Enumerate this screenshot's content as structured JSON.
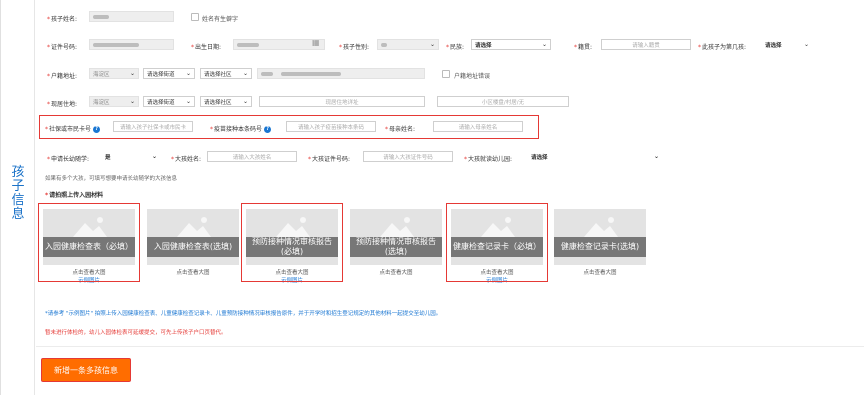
{
  "sidebar": {
    "title_chars": [
      "孩",
      "子",
      "信",
      "息"
    ]
  },
  "row1": {
    "child_name_label": "孩子姓名:",
    "rare_char_label": "姓名有生僻字"
  },
  "row2": {
    "id_label": "证件号码:",
    "dob_label": "出生日期:",
    "gender_label": "孩子性别:",
    "nation_label": "民族:",
    "nation_value": "请选择",
    "origin_label": "籍贯:",
    "origin_placeholder": "请输入籍贯",
    "order_label": "此孩子为第几孩:",
    "order_value": "请选择"
  },
  "row3": {
    "hukou_label": "户籍地址:",
    "district_value": "海淀区",
    "street_value": "请选择街道",
    "community_value": "请选择社区",
    "hukou_error_label": "户籍地址错误"
  },
  "row4": {
    "residence_label": "现居住地:",
    "district_value": "海淀区",
    "street_value": "请选择街道",
    "community_value": "请选择社区",
    "address_placeholder": "现居住地详址",
    "building_placeholder": "小区楼盘/村居/无"
  },
  "row5": {
    "social_label": "社保或市民卡号",
    "social_placeholder": "请输入孩子社保卡或市民卡",
    "vaccine_label": "疫苗接种本条码号",
    "vaccine_placeholder": "请输入孩子疫苗接种本条码",
    "mother_label": "母亲姓名:",
    "mother_placeholder": "请输入母亲姓名",
    "help_glyph": "?"
  },
  "row6": {
    "sibling_label": "申请长幼随学:",
    "sibling_value": "是",
    "elder_name_label": "大孩姓名:",
    "elder_name_placeholder": "请输入大孩姓名",
    "elder_id_label": "大孩证件号码:",
    "elder_id_placeholder": "请输入大孩证件号码",
    "elder_kg_label": "大孩就读幼儿园:",
    "elder_kg_value": "请选择"
  },
  "notes": {
    "multi_child": "如果有多个大孩，可填写想要申请长幼随学的大孩信息",
    "upload_title": "请拍照上传入园材料",
    "instruction": "*请参考 \"示例图片\" 拍照上传入园健康检查表、儿童健康检查记录卡、儿童预防接种情况审核报告原件，并于开学时和招生登记规定的其他材料一起提交至幼儿园。",
    "warning": "暂未进行体检的，幼儿入园体检表可延缓提交，可先上传孩子户口页替代。"
  },
  "cards": [
    {
      "caption": "入园健康检查表（必填）",
      "view": "点击查看大图",
      "sample": "示例图片"
    },
    {
      "caption": "入园健康检查表(选填)",
      "view": "点击查看大图",
      "sample": ""
    },
    {
      "caption": "预防接种情况审核报告(必填)",
      "view": "点击查看大图",
      "sample": "示例图片"
    },
    {
      "caption": "预防接种情况审核报告(选填)",
      "view": "点击查看大图",
      "sample": ""
    },
    {
      "caption": "健康检查记录卡（必填）",
      "view": "点击查看大图",
      "sample": "示例图片"
    },
    {
      "caption": "健康检查记录卡(选填)",
      "view": "点击查看大图",
      "sample": ""
    }
  ],
  "add_button": "新增一条多孩信息",
  "icons": {
    "calendar": "calendar-icon",
    "chevron": "chevron-down-icon",
    "help": "help-icon",
    "image": "image-placeholder-icon"
  },
  "colors": {
    "accent_blue": "#1976d2",
    "required_red": "#e53935",
    "button_orange": "#ff6d00"
  }
}
